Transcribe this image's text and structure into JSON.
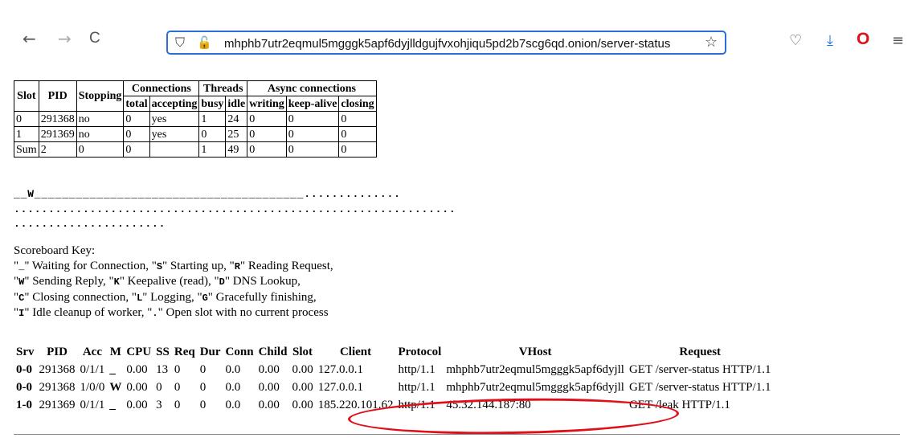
{
  "browser": {
    "url": "mhphb7utr2eqmul5mgggk5apf6dyjlldgujfvxohjiqu5pd2b7scg6qd.onion/server-status",
    "icons": [
      "back-arrow-icon",
      "forward-arrow-icon",
      "reload-icon",
      "shield-icon",
      "lock-broken-icon",
      "star-icon",
      "pocket-icon",
      "download-icon",
      "opera-icon",
      "menu-icon"
    ],
    "glyphs": {
      "back": "←",
      "forward": "→",
      "reload": "C",
      "shield": "⛉",
      "lock": "🔓",
      "star": "☆",
      "pocket": "♡",
      "download": "⤓",
      "opera": "O",
      "menu": "≡"
    }
  },
  "workers": {
    "headers": {
      "slot": "Slot",
      "pid": "PID",
      "stopping": "Stopping",
      "connections": "Connections",
      "threads": "Threads",
      "async": "Async connections",
      "total": "total",
      "accepting": "accepting",
      "busy": "busy",
      "idle": "idle",
      "writing": "writing",
      "keepalive": "keep-alive",
      "closing": "closing"
    },
    "rows": [
      [
        "0",
        "291368",
        "no",
        "0",
        "yes",
        "1",
        "24",
        "0",
        "0",
        "0"
      ],
      [
        "1",
        "291369",
        "no",
        "0",
        "yes",
        "0",
        "25",
        "0",
        "0",
        "0"
      ],
      [
        "Sum",
        "2",
        "0",
        "0",
        "",
        "1",
        "49",
        "0",
        "0",
        "0"
      ]
    ]
  },
  "scoreboard": {
    "line1": "__W_______________________________________..............",
    "line2": "................................................................",
    "line3": "......................"
  },
  "key": {
    "title": "Scoreboard Key:",
    "lines": [
      [
        [
          "\"",
          "_",
          "\" Waiting for Connection, \""
        ],
        [
          "S"
        ],
        [
          "\" Starting up, \""
        ],
        [
          "R"
        ],
        [
          "\" Reading Request,"
        ]
      ],
      [
        [
          "\"",
          "W",
          "\" Sending Reply, \""
        ],
        [
          "K"
        ],
        [
          "\" Keepalive (read), \""
        ],
        [
          "D"
        ],
        [
          "\" DNS Lookup,"
        ]
      ],
      [
        [
          "\"",
          "C",
          "\" Closing connection, \""
        ],
        [
          "L"
        ],
        [
          "\" Logging, \""
        ],
        [
          "G"
        ],
        [
          "\" Gracefully finishing,"
        ]
      ],
      [
        [
          "\"",
          "I",
          "\" Idle cleanup of worker, \""
        ],
        [
          "."
        ],
        [
          "\" Open slot with no current process"
        ]
      ]
    ]
  },
  "requests": {
    "headers": [
      "Srv",
      "PID",
      "Acc",
      "M",
      "CPU",
      "SS",
      "Req",
      "Dur",
      "Conn",
      "Child",
      "Slot",
      "Client",
      "Protocol",
      "VHost",
      "Request"
    ],
    "rows": [
      [
        "0-0",
        "291368",
        "0/1/1",
        "_",
        "0.00",
        "13",
        "0",
        "0",
        "0.0",
        "0.00",
        "0.00",
        "127.0.0.1",
        "http/1.1",
        "mhphb7utr2eqmul5mgggk5apf6dyjll",
        "GET /server-status HTTP/1.1"
      ],
      [
        "0-0",
        "291368",
        "1/0/0",
        "W",
        "0.00",
        "0",
        "0",
        "0",
        "0.0",
        "0.00",
        "0.00",
        "127.0.0.1",
        "http/1.1",
        "mhphb7utr2eqmul5mgggk5apf6dyjll",
        "GET /server-status HTTP/1.1"
      ],
      [
        "1-0",
        "291369",
        "0/1/1",
        "_",
        "0.00",
        "3",
        "0",
        "0",
        "0.0",
        "0.00",
        "0.00",
        "185.220.101.62",
        "http/1.1",
        "45.32.144.187:80",
        "GET /leak HTTP/1.1"
      ]
    ]
  },
  "colors": {
    "highlight": "#e0101a",
    "urlbar_border": "#2a6fd6",
    "opera": "#e0101a",
    "download": "#1a73e8"
  }
}
